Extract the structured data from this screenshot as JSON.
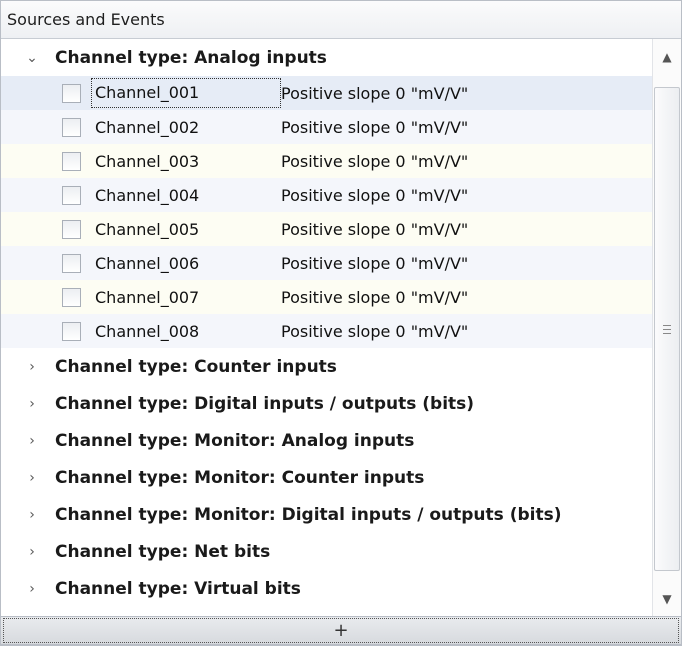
{
  "panel": {
    "title": "Sources and Events"
  },
  "tree": {
    "expanded_group": {
      "chevron": "chevron-down-icon",
      "label": "Channel type: Analog inputs",
      "rows": [
        {
          "name": "Channel_001",
          "event": "Positive slope 0 \"mV/V\"",
          "selected": true
        },
        {
          "name": "Channel_002",
          "event": "Positive slope 0 \"mV/V\""
        },
        {
          "name": "Channel_003",
          "event": "Positive slope 0 \"mV/V\""
        },
        {
          "name": "Channel_004",
          "event": "Positive slope 0 \"mV/V\""
        },
        {
          "name": "Channel_005",
          "event": "Positive slope 0 \"mV/V\""
        },
        {
          "name": "Channel_006",
          "event": "Positive slope 0 \"mV/V\""
        },
        {
          "name": "Channel_007",
          "event": "Positive slope 0 \"mV/V\""
        },
        {
          "name": "Channel_008",
          "event": "Positive slope 0 \"mV/V\""
        }
      ]
    },
    "collapsed_groups": [
      {
        "label": "Channel type: Counter inputs"
      },
      {
        "label": "Channel type: Digital inputs / outputs (bits)"
      },
      {
        "label": "Channel type: Monitor: Analog inputs"
      },
      {
        "label": "Channel type: Monitor: Counter inputs"
      },
      {
        "label": "Channel type: Monitor: Digital inputs / outputs (bits)"
      },
      {
        "label": "Channel type: Net bits"
      },
      {
        "label": "Channel type: Virtual bits"
      }
    ]
  },
  "glyphs": {
    "expanded": "⌄",
    "collapsed": "›",
    "scroll_up": "▲",
    "scroll_down": "▼"
  },
  "footer": {
    "add_label": "+"
  }
}
